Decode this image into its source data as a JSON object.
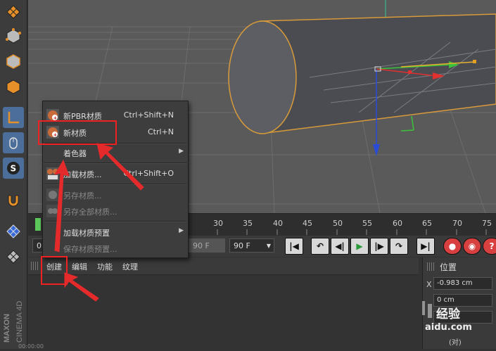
{
  "context_menu": {
    "items": [
      {
        "label": "新PBR材质",
        "shortcut": "Ctrl+Shift+N"
      },
      {
        "label": "新材质",
        "shortcut": "Ctrl+N"
      },
      {
        "label": "着色器",
        "shortcut": ""
      },
      {
        "label": "加载材质...",
        "shortcut": "Ctrl+Shift+O"
      },
      {
        "label": "另存材质...",
        "shortcut": ""
      },
      {
        "label": "另存全部材质...",
        "shortcut": ""
      },
      {
        "label": "加载材质预置",
        "shortcut": ""
      },
      {
        "label": "保存材质预置...",
        "shortcut": ""
      }
    ]
  },
  "timeline": {
    "ticks": [
      "30",
      "35",
      "40",
      "45",
      "50",
      "55",
      "60",
      "65",
      "70",
      "75"
    ],
    "start_field": "0",
    "frame_field_1": "90 F",
    "frame_field_2": "90 F"
  },
  "material_menu": {
    "create": "创建",
    "edit": "编辑",
    "function": "功能",
    "texture": "纹理"
  },
  "attributes": {
    "title": "位置",
    "x_label": "X",
    "x_value": "-0.983 cm",
    "y_value": "0 cm",
    "z_value": "cm"
  },
  "logo": {
    "brand": "MAXON",
    "product": "CINEMA 4D"
  },
  "watermark": {
    "line1": "经验",
    "line2": "aidu.com",
    "line3": "(对)"
  },
  "status": {
    "time": "00:00:00"
  },
  "colors": {
    "accent_selected": "#4b6e9a",
    "annotation_red": "#e22222"
  }
}
